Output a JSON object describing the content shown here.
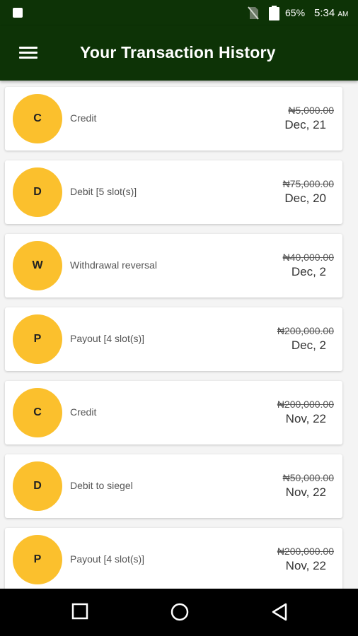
{
  "status_bar": {
    "battery_percent": "65%",
    "time": "5:34",
    "ampm": "AM"
  },
  "app_bar": {
    "title": "Your Transaction History",
    "menu_icon": "hamburger-menu-icon"
  },
  "transactions": [
    {
      "initial": "C",
      "description": "Credit",
      "amount": "₦5,000.00",
      "date": "Dec, 21"
    },
    {
      "initial": "D",
      "description": "Debit [5 slot(s)]",
      "amount": "₦75,000.00",
      "date": "Dec, 20"
    },
    {
      "initial": "W",
      "description": "Withdrawal reversal",
      "amount": "₦40,000.00",
      "date": "Dec, 2"
    },
    {
      "initial": "P",
      "description": "Payout [4 slot(s)]",
      "amount": "₦200,000.00",
      "date": "Dec, 2"
    },
    {
      "initial": "C",
      "description": "Credit",
      "amount": "₦200,000.00",
      "date": "Nov, 22"
    },
    {
      "initial": "D",
      "description": "Debit to siegel",
      "amount": "₦50,000.00",
      "date": "Nov, 22"
    },
    {
      "initial": "P",
      "description": "Payout [4 slot(s)]",
      "amount": "₦200,000.00",
      "date": "Nov, 22"
    }
  ],
  "colors": {
    "primary": "#0d3306",
    "avatar": "#fbc02d",
    "background": "#f4f4f4"
  },
  "nav_bar": {
    "icons": [
      "recents-square-icon",
      "home-circle-icon",
      "back-triangle-icon"
    ]
  }
}
